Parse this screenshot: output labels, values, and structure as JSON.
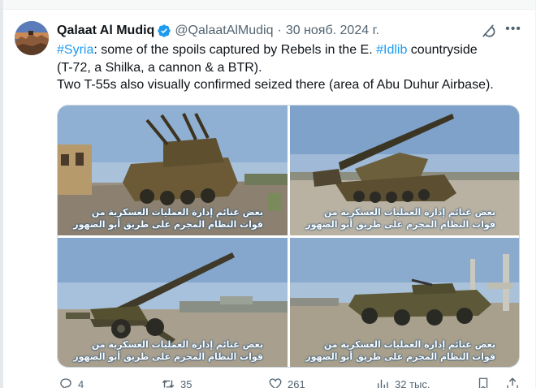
{
  "tweet": {
    "author": {
      "display_name": "Qalaat Al Mudiq",
      "handle": "@QalaatAlMudiq",
      "verified_badge": "verified-badge-icon"
    },
    "separator": "·",
    "date": "30 нояб. 2024 г.",
    "text": {
      "line1": {
        "hashtag1": "#Syria",
        "part1": ": some of the spoils captured by Rebels in the E. ",
        "hashtag2": "#Idlib",
        "part2": " countryside"
      },
      "line2": "(T-72, a Shilka, a cannon & a BTR).",
      "line3": "Two T-55s also visually confirmed seized there (area of Abu Duhur Airbase)."
    },
    "media": [
      {
        "subject": "Shilka anti-aircraft vehicle",
        "caption_line1": "بعض غنائم إدارة العمليات العسكرية من",
        "caption_line2": "قوات النظام المجرم على طريق أبو الضهور"
      },
      {
        "subject": "T-72 tank",
        "caption_line1": "بعض غنائم إدارة العمليات العسكرية من",
        "caption_line2": "قوات النظام المجرم على طريق أبو الضهور"
      },
      {
        "subject": "towed cannon",
        "caption_line1": "بعض غنائم إدارة العمليات العسكرية من",
        "caption_line2": "قوات النظام المجرم على طريق أبو الضهور"
      },
      {
        "subject": "BTR armored vehicle",
        "caption_line1": "بعض غنائم إدارة العمليات العسكرية من",
        "caption_line2": "قوات النظام المجرم على طريق أبو الضهور"
      }
    ],
    "actions": {
      "replies": "4",
      "reposts": "35",
      "likes": "261",
      "views": "32 тыс."
    }
  },
  "icons": {
    "grok": "grok-icon",
    "more": "more-icon",
    "reply": "reply-icon",
    "repost": "repost-icon",
    "like": "like-icon",
    "views": "views-icon",
    "bookmark": "bookmark-icon",
    "share": "share-icon"
  },
  "colors": {
    "link": "#1d9bf0",
    "text": "#0f1419",
    "secondary": "#536471",
    "badge": "#1d9bf0"
  }
}
